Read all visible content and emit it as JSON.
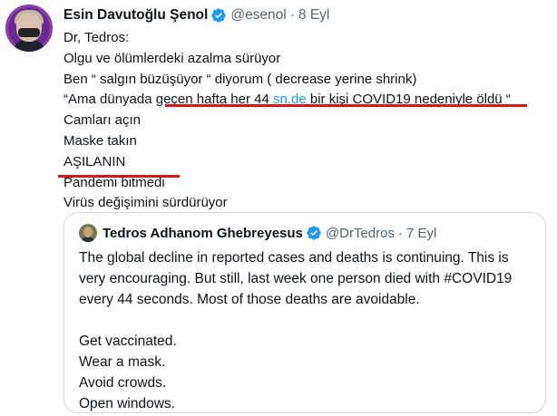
{
  "tweet": {
    "author_name": "Esin Davutoğlu Şenol",
    "handle": "@esenol",
    "separator": "·",
    "date": "8 Eyl",
    "lines": {
      "l0": "Dr, Tedros:",
      "l1": "Olgu ve ölümlerdeki azalma sürüyor",
      "l2": "Ben “ salgın büzüşüyor “ diyorum ( decrease yerine shrink)",
      "l3_pre": "“Ama dünyada geçen hafta her 44 ",
      "l3_link": "sn.de",
      "l3_post": " bir kişi COVID19 nedeniyle öldü  “",
      "l4": "Camları açın",
      "l5": "Maske takın",
      "l6": "AŞILANIN",
      "l7": "Pandemi bitmedi",
      "l8": "Virüs değişimini sürdürüyor"
    }
  },
  "quoted": {
    "author_name": "Tedros Adhanom Ghebreyesus",
    "handle": "@DrTedros",
    "separator": "·",
    "date": "7 Eyl",
    "lines": {
      "l0": "The global decline in reported cases and deaths is continuing. This is",
      "l1": "very encouraging. But still, last week one person died with #COVID19",
      "l2": "every 44 seconds. Most of those deaths are avoidable.",
      "l3": "",
      "l4": "Get vaccinated.",
      "l5": "Wear a mask.",
      "l6": "Avoid crowds.",
      "l7": "Open windows."
    }
  },
  "icons": {
    "verified": "verified-badge-icon"
  },
  "colors": {
    "verified_blue": "#1d9bf0",
    "link_blue": "#1d9bf0",
    "annotation_red": "#d9161c",
    "secondary_text": "#536471"
  }
}
